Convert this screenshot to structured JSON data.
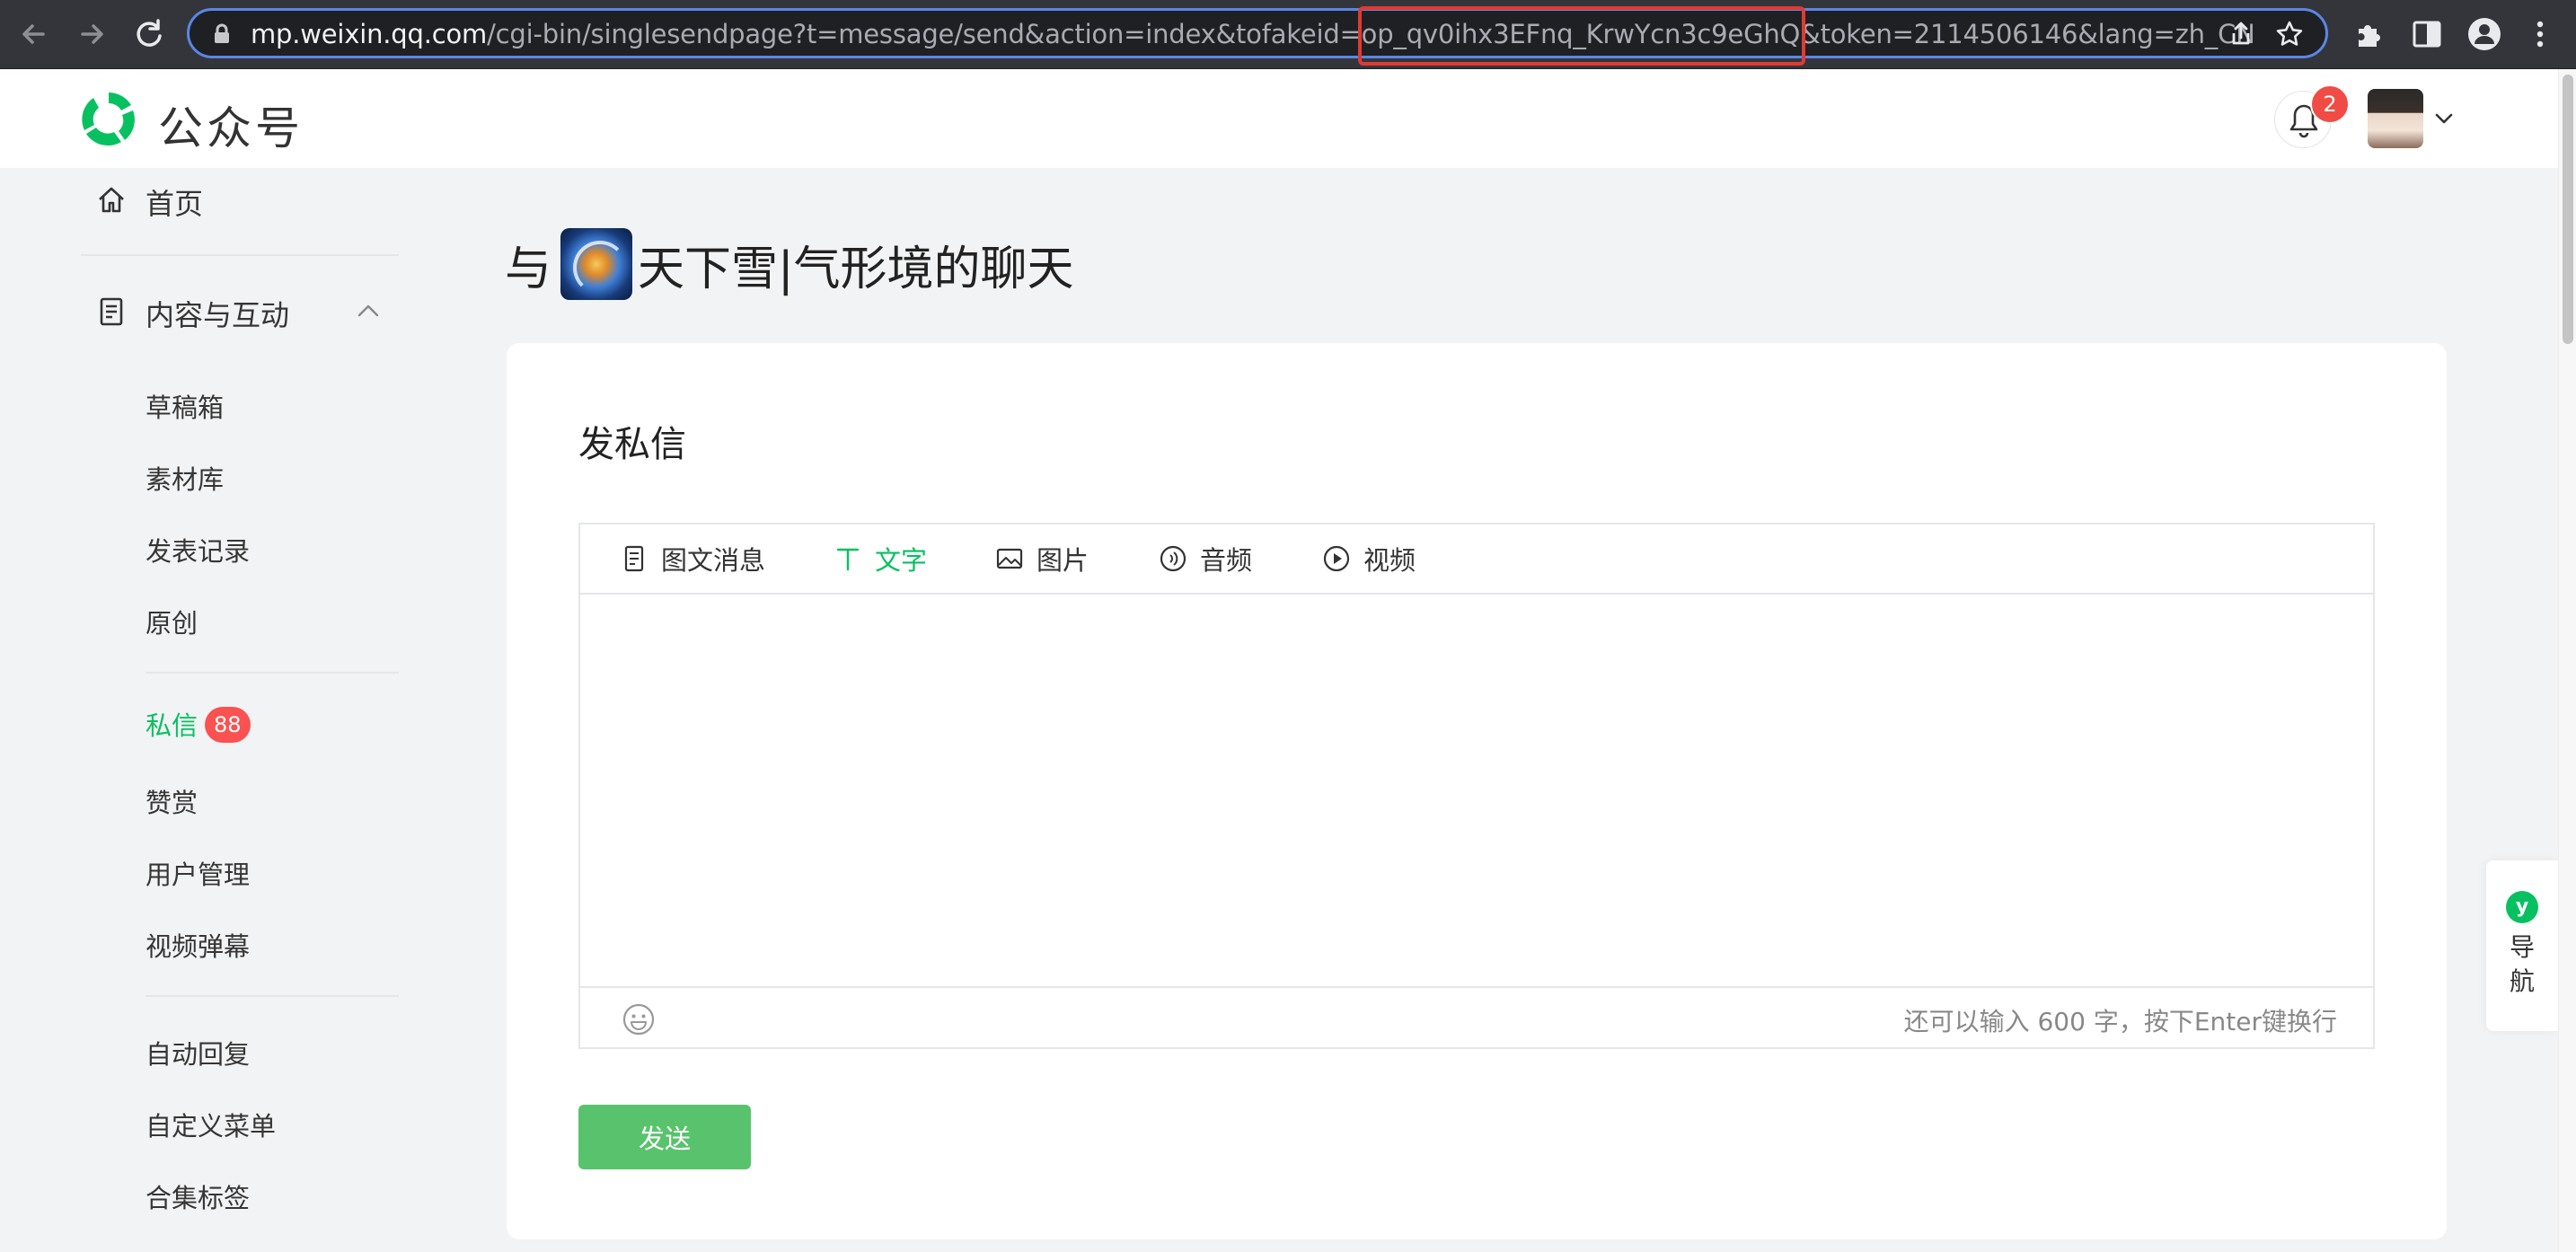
{
  "browser": {
    "url_host": "mp.weixin.qq.com",
    "url_path_before": "/cgi-bin/singlesendpage?t=message/send&action=index&tofakeid=",
    "url_highlight": "op_qv0ihx3EFnq_KrwYcn3c9eGhQ",
    "url_path_after": "&token=2114506146&lang=zh_CN"
  },
  "header": {
    "logo_text": "公众号",
    "notification_count": "2"
  },
  "sidebar": {
    "home": "首页",
    "section_content": "内容与互动",
    "items_group1": [
      "草稿箱",
      "素材库",
      "发表记录",
      "原创"
    ],
    "messages": "私信",
    "messages_badge": "88",
    "items_group2": [
      "赞赏",
      "用户管理",
      "视频弹幕"
    ],
    "items_group3": [
      "自动回复",
      "自定义菜单",
      "合集标签"
    ]
  },
  "main": {
    "chat_prefix": "与",
    "chat_name": "天下雪|气形境的聊天",
    "card_title": "发私信",
    "tabs": [
      "图文消息",
      "文字",
      "图片",
      "音频",
      "视频"
    ],
    "active_tab": "文字",
    "text_value": "",
    "counter_text": "还可以输入 600 字，按下Enter键换行",
    "send_label": "发送"
  },
  "float_nav": {
    "label": "导航"
  },
  "colors": {
    "accent": "#07c160",
    "badge": "#fa5151",
    "url_highlight_border": "#e03a34"
  }
}
